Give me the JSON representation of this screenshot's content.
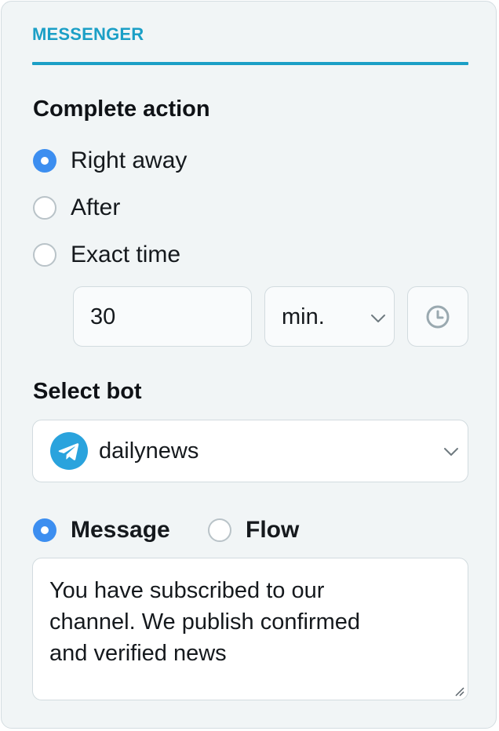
{
  "tab": {
    "label": "MESSENGER"
  },
  "complete_action": {
    "title": "Complete action",
    "options": [
      {
        "label": "Right away",
        "selected": true
      },
      {
        "label": "After",
        "selected": false
      },
      {
        "label": "Exact time",
        "selected": false
      }
    ],
    "delay_value": "30",
    "unit_selected": "min.",
    "time_icon": "clock-icon"
  },
  "select_bot": {
    "title": "Select bot",
    "bot_name": "dailynews",
    "bot_icon": "telegram-icon"
  },
  "content_type": {
    "options": [
      {
        "label": "Message",
        "selected": true
      },
      {
        "label": "Flow",
        "selected": false
      }
    ]
  },
  "message": {
    "text": "You have subscribed to our\nchannel. We publish confirmed\nand verified news"
  },
  "colors": {
    "accent": "#1b9fc6",
    "radio_selected": "#3c8ef0",
    "telegram": "#2aa3dd"
  }
}
